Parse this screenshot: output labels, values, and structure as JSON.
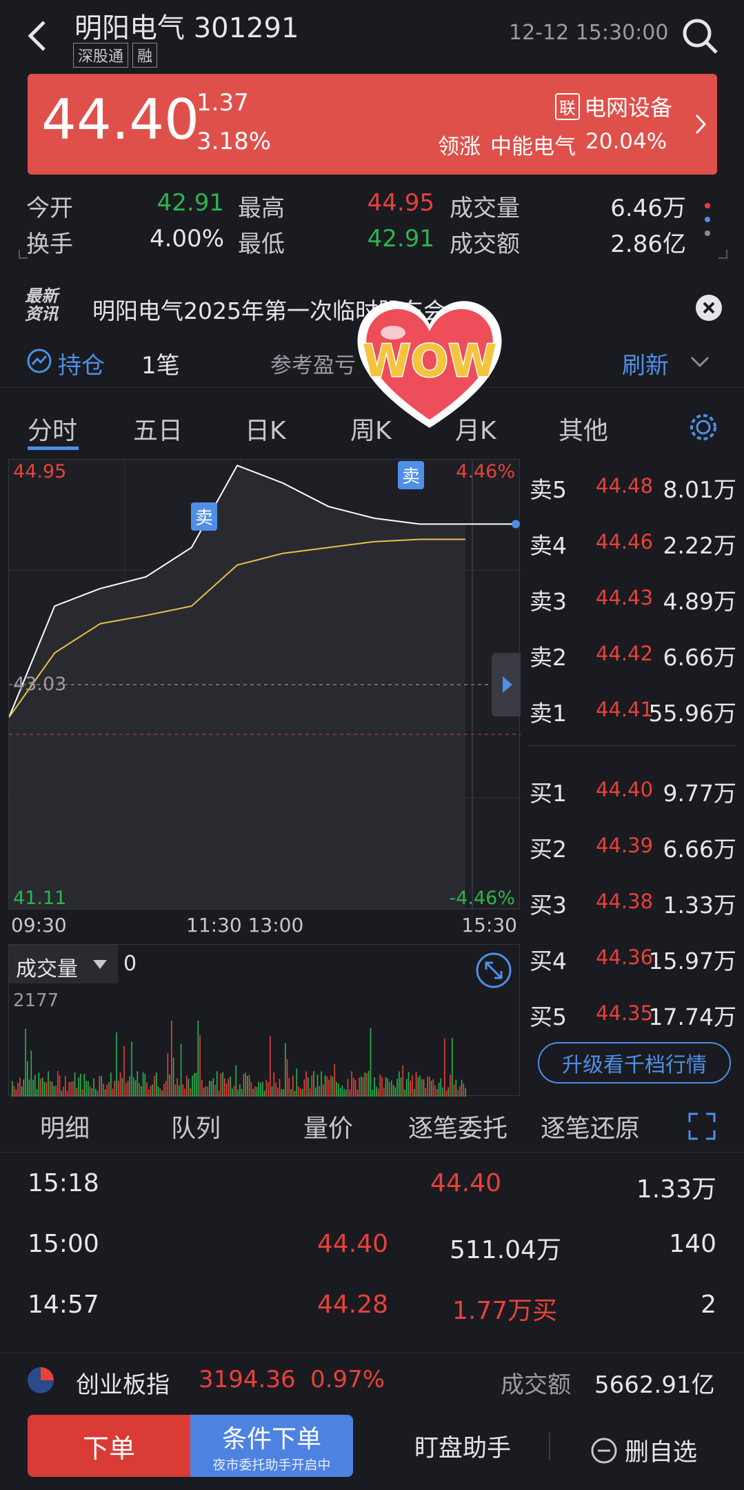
{
  "header": {
    "stock_name": "明阳电气",
    "code": "301291",
    "tag1": "深股通",
    "tag2": "融",
    "datetime": "12-12 15:30:00"
  },
  "price": {
    "last": "44.40",
    "change": "1.37",
    "change_pct": "3.18%",
    "sector_tag": "联",
    "sector": "电网设备",
    "leader_label": "领涨",
    "leader_name": "中能电气",
    "leader_pct": "20.04%"
  },
  "stats": {
    "open_label": "今开",
    "open": "42.91",
    "high_label": "最高",
    "high": "44.95",
    "volume_label": "成交量",
    "volume": "6.46万",
    "turnover_label": "换手",
    "turnover": "4.00%",
    "low_label": "最低",
    "low": "42.91",
    "amount_label": "成交额",
    "amount": "2.86亿"
  },
  "news": {
    "badge_line1": "最新",
    "badge_line2": "资讯",
    "text": "明阳电气2025年第一次临时股东会"
  },
  "position": {
    "label": "持仓",
    "count": "1笔",
    "ref": "参考盈亏",
    "refresh": "刷新"
  },
  "sticker": {
    "text": "WOW"
  },
  "tabs": [
    "分时",
    "五日",
    "日K",
    "周K",
    "月K",
    "其他"
  ],
  "chart": {
    "y_top": "44.95",
    "y_mid": "43.03",
    "y_bot": "41.11",
    "pct_top": "4.46%",
    "pct_bot": "-4.46%",
    "x_labels": [
      "09:30",
      "11:30 13:00",
      "15:30"
    ],
    "marker_sell": "卖"
  },
  "chart_data": {
    "type": "line",
    "title": "",
    "xlabel": "",
    "ylabel": "",
    "ylim": [
      41.11,
      44.95
    ],
    "x": [
      "09:30",
      "10:00",
      "10:30",
      "11:00",
      "11:30",
      "13:00",
      "13:30",
      "14:00",
      "14:30",
      "15:00",
      "15:30"
    ],
    "series": [
      {
        "name": "",
        "values": [
          42.75,
          43.7,
          43.85,
          43.95,
          44.2,
          44.9,
          44.75,
          44.55,
          44.45,
          44.4,
          44.4
        ]
      },
      {
        "name": "",
        "values": [
          42.75,
          43.3,
          43.55,
          43.62,
          43.7,
          44.05,
          44.15,
          44.2,
          44.25,
          44.27,
          44.27
        ]
      }
    ]
  },
  "orderbook": {
    "asks": [
      {
        "l": "卖5",
        "p": "44.48",
        "v": "8.01万"
      },
      {
        "l": "卖4",
        "p": "44.46",
        "v": "2.22万"
      },
      {
        "l": "卖3",
        "p": "44.43",
        "v": "4.89万"
      },
      {
        "l": "卖2",
        "p": "44.42",
        "v": "6.66万"
      },
      {
        "l": "卖1",
        "p": "44.41",
        "v": "55.96万"
      }
    ],
    "bids": [
      {
        "l": "买1",
        "p": "44.40",
        "v": "9.77万"
      },
      {
        "l": "买2",
        "p": "44.39",
        "v": "6.66万"
      },
      {
        "l": "买3",
        "p": "44.38",
        "v": "1.33万"
      },
      {
        "l": "买4",
        "p": "44.36",
        "v": "15.97万"
      },
      {
        "l": "买5",
        "p": "44.35",
        "v": "17.74万"
      }
    ],
    "upgrade": "升级看千档行情"
  },
  "volume": {
    "label": "成交量",
    "value": "0",
    "max": "2177"
  },
  "detail_tabs": [
    "明细",
    "队列",
    "量价",
    "逐笔委托",
    "逐笔还原"
  ],
  "trades": [
    {
      "t": "15:18",
      "a": "",
      "b": "44.40",
      "c": "1.33万"
    },
    {
      "t": "15:00",
      "a": "44.40",
      "b": "511.04万",
      "c": "140"
    },
    {
      "t": "14:57",
      "a": "44.28",
      "b": "1.77万买",
      "c": "2"
    }
  ],
  "index": {
    "name": "创业板指",
    "value": "3194.36",
    "pct": "0.97%",
    "amount_label": "成交额",
    "amount": "5662.91亿"
  },
  "bottom": {
    "order": "下单",
    "cond": "条件下单",
    "cond_sub": "夜市委托助手开启中",
    "assist": "盯盘助手",
    "remove": "删自选"
  },
  "colors": {
    "up": "#e8413c",
    "down": "#2fb34f",
    "accent": "#4e8fe8",
    "price_bg": "#e0504a"
  }
}
